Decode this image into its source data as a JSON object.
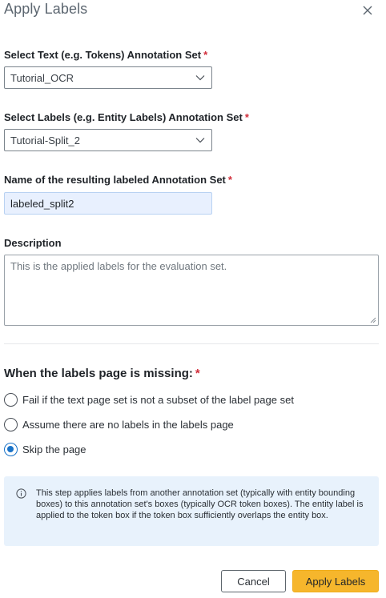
{
  "dialog": {
    "title": "Apply Labels"
  },
  "fields": {
    "text_set": {
      "label": "Select Text (e.g. Tokens) Annotation Set",
      "required": "*",
      "value": "Tutorial_OCR"
    },
    "labels_set": {
      "label": "Select Labels (e.g. Entity Labels) Annotation Set",
      "required": "*",
      "value": "Tutorial-Split_2"
    },
    "result_name": {
      "label": "Name of the resulting labeled Annotation Set",
      "required": "*",
      "value": "labeled_split2"
    },
    "description": {
      "label": "Description",
      "placeholder": "This is the applied labels for the evaluation set."
    }
  },
  "missing_page": {
    "heading": "When the labels page is missing:",
    "required": "*",
    "options": [
      {
        "label": "Fail if the text page set is not a subset of the label page set",
        "checked": false
      },
      {
        "label": "Assume there are no labels in the labels page",
        "checked": false
      },
      {
        "label": "Skip the page",
        "checked": true
      }
    ]
  },
  "info": {
    "text": "This step applies labels from another annotation set (typically with entity bounding boxes) to this annotation set's boxes (typically OCR token boxes). The entity label is applied to the token box if the token box sufficiently overlaps the entity box."
  },
  "footer": {
    "cancel_label": "Cancel",
    "apply_label": "Apply Labels"
  },
  "colors": {
    "primary_button": "#f6b62c",
    "required_marker": "#d12d3a",
    "radio_selected": "#1a73c8",
    "info_background": "#e8f2fc",
    "autofill_background": "#e8f0fe"
  }
}
